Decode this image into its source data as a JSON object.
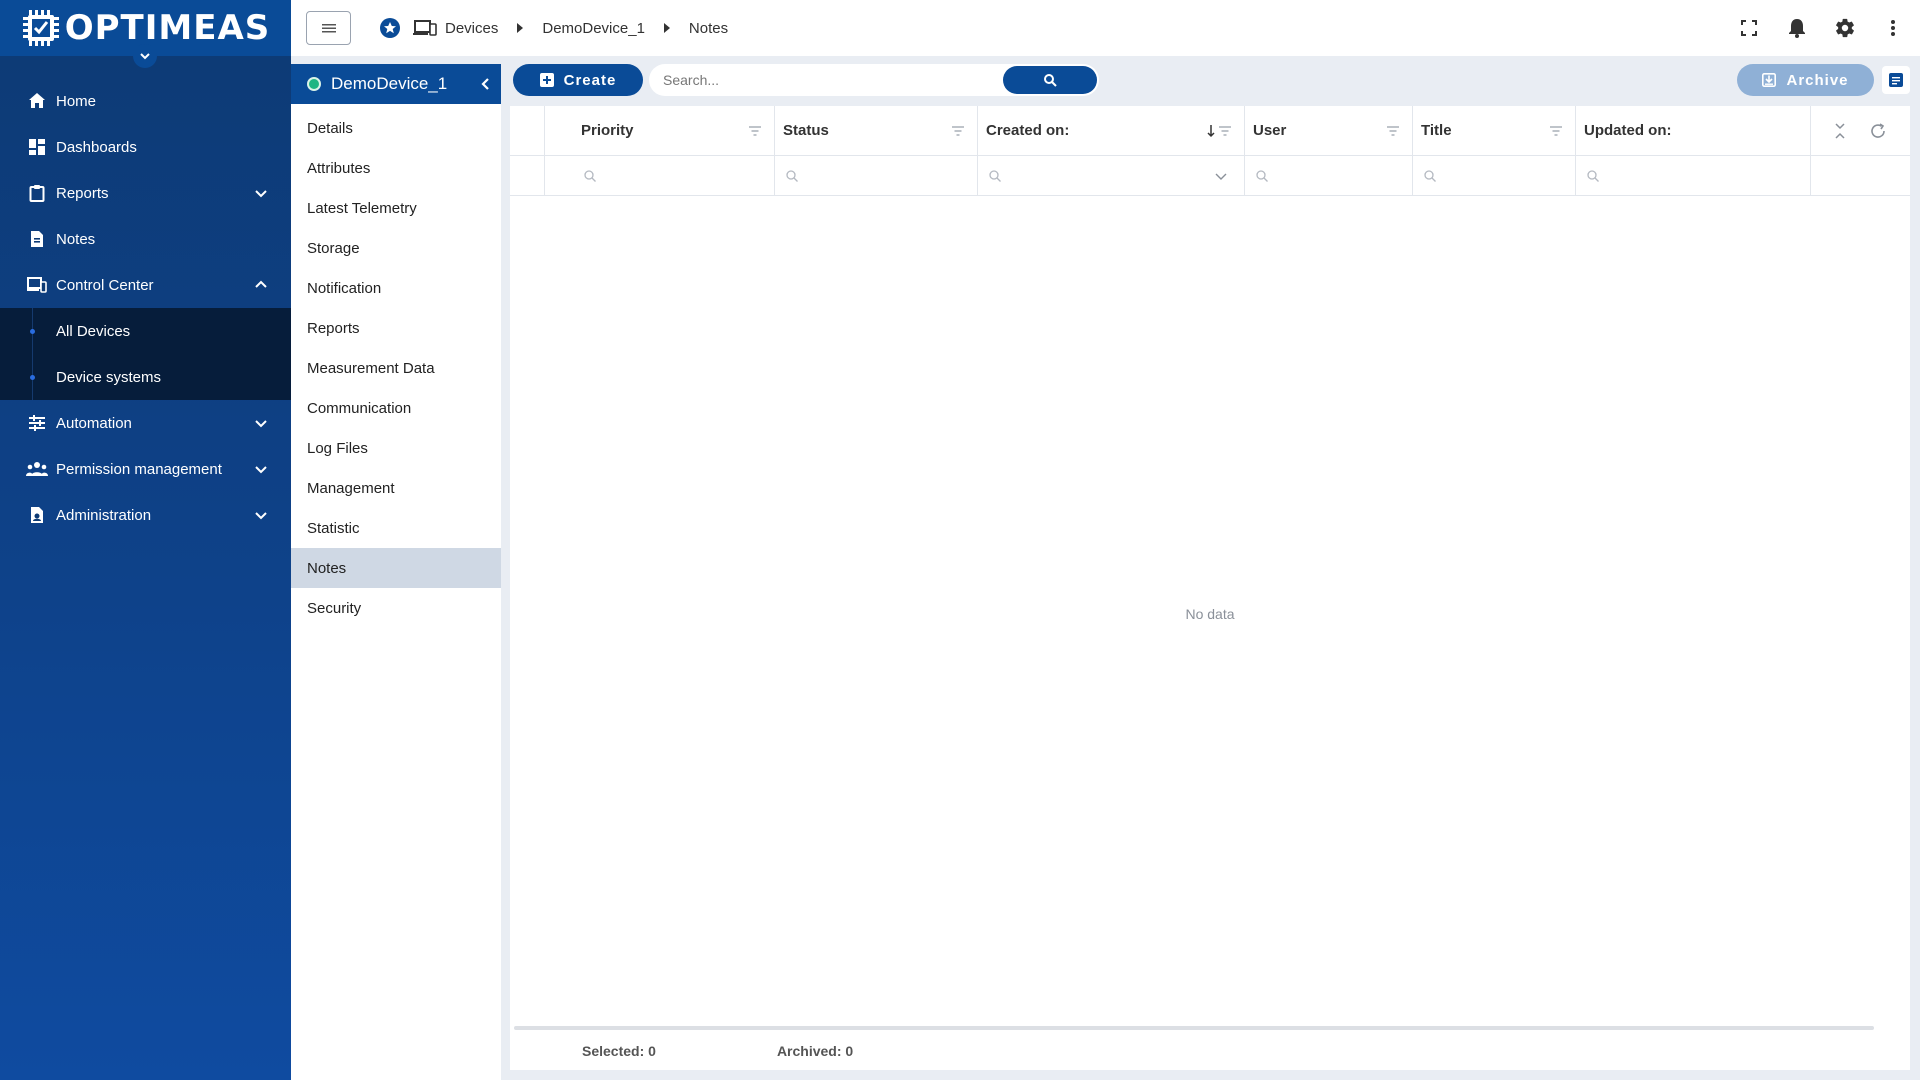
{
  "brand": {
    "name": "OPTIMEAS"
  },
  "sidebar": {
    "items": [
      {
        "label": "Home",
        "icon": "home-icon"
      },
      {
        "label": "Dashboards",
        "icon": "dashboards-icon"
      },
      {
        "label": "Reports",
        "icon": "reports-icon",
        "expandable": true
      },
      {
        "label": "Notes",
        "icon": "notes-icon"
      },
      {
        "label": "Control Center",
        "icon": "devices-icon",
        "expanded": true
      },
      {
        "label": "Automation",
        "icon": "automation-icon",
        "expandable": true
      },
      {
        "label": "Permission management",
        "icon": "people-icon",
        "expandable": true
      },
      {
        "label": "Administration",
        "icon": "admin-icon",
        "expandable": true
      }
    ],
    "control_center_children": [
      {
        "label": "All Devices"
      },
      {
        "label": "Device systems"
      }
    ]
  },
  "breadcrumb": {
    "items": [
      "Devices",
      "DemoDevice_1",
      "Notes"
    ]
  },
  "detail_menu": {
    "device_name": "DemoDevice_1",
    "items": [
      "Details",
      "Attributes",
      "Latest Telemetry",
      "Storage",
      "Notification",
      "Reports",
      "Measurement Data",
      "Communication",
      "Log Files",
      "Management",
      "Statistic",
      "Notes",
      "Security"
    ],
    "active": "Notes"
  },
  "toolbar": {
    "create_label": "Create",
    "search_placeholder": "Search...",
    "archive_label": "Archive"
  },
  "table": {
    "columns": [
      "Priority",
      "Status",
      "Created on:",
      "User",
      "Title",
      "Updated on:"
    ],
    "empty_text": "No data"
  },
  "footer": {
    "selected": "Selected: 0",
    "archived": "Archived: 0"
  },
  "colors": {
    "brand_blue": "#0a4b97",
    "sidebar_dark": "#061d3b",
    "online_green": "#1db583",
    "archive_disabled": "#8fb0d6"
  }
}
